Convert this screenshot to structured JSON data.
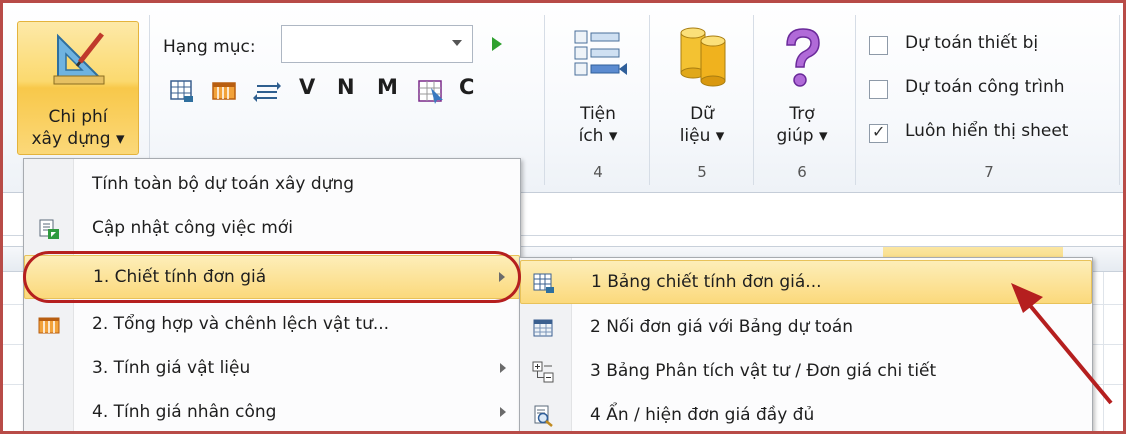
{
  "ribbon": {
    "chi_phi": {
      "line1": "Chi phí",
      "line2": "xây dựng ▾"
    },
    "hang_muc": {
      "label": "Hạng mục:",
      "value": ""
    },
    "letters": [
      "V",
      "N",
      "M",
      "C"
    ],
    "groups": [
      {
        "line1": "Tiện",
        "line2": "ích ▾",
        "num": "4"
      },
      {
        "line1": "Dữ",
        "line2": "liệu ▾",
        "num": "5"
      },
      {
        "line1": "Trợ",
        "line2": "giúp ▾",
        "num": "6"
      }
    ],
    "checks": [
      {
        "label": "Dự toán thiết bị",
        "checked": false
      },
      {
        "label": "Dự toán công trình",
        "checked": false
      },
      {
        "label": "Luôn hiển thị sheet",
        "checked": true
      }
    ],
    "group7_num": "7"
  },
  "menu": {
    "items": [
      {
        "label": "Tính toàn bộ dự toán xây dựng",
        "icon": "none",
        "submenu": false
      },
      {
        "label": "Cập nhật công việc mới",
        "icon": "update-doc-icon",
        "submenu": false
      },
      {
        "label": "1. Chiết tính đơn giá",
        "icon": "none",
        "submenu": true,
        "highlighted": true
      },
      {
        "label": "2. Tổng hợp và chênh lệch vật tư...",
        "icon": "table-orange-icon",
        "submenu": false
      },
      {
        "label": "3. Tính giá vật liệu",
        "icon": "none",
        "submenu": true
      },
      {
        "label": "4. Tính giá nhân công",
        "icon": "none",
        "submenu": true
      }
    ]
  },
  "submenu": {
    "items": [
      {
        "label": "1 Bảng chiết tính đơn giá...",
        "icon": "grid-table-icon",
        "highlighted": true
      },
      {
        "label": "2 Nối đơn giá với Bảng dự toán",
        "icon": "calendar-grid-icon"
      },
      {
        "label": "3 Bảng Phân tích vật tư / Đơn giá chi tiết",
        "icon": "expand-collapse-icon"
      },
      {
        "label": "4 Ẩn / hiện đơn giá đầy đủ",
        "icon": "zoom-doc-icon"
      }
    ]
  },
  "colors": {
    "highlight": "#fbd97c",
    "annotation": "#b51f1f",
    "frame": "#b84b47"
  }
}
